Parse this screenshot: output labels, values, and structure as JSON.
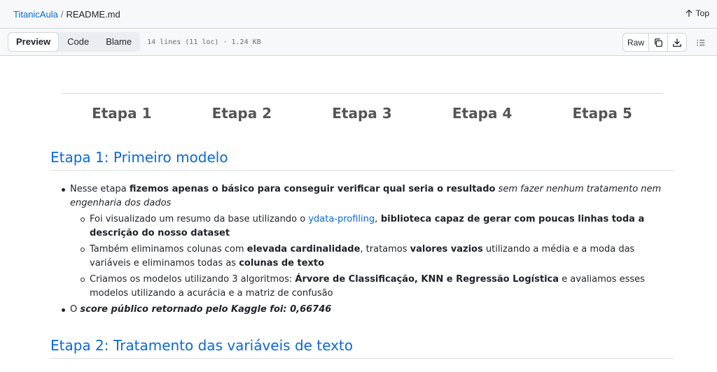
{
  "breadcrumb": {
    "repo": "TitanicAula",
    "separator": "/",
    "file": "README.md"
  },
  "top_link": {
    "label": "Top"
  },
  "toolbar": {
    "tabs": [
      {
        "label": "Preview"
      },
      {
        "label": "Code"
      },
      {
        "label": "Blame"
      }
    ],
    "meta": "14 lines (11 loc) · 1.24 KB",
    "raw_label": "Raw"
  },
  "steps": [
    "Etapa 1",
    "Etapa 2",
    "Etapa 3",
    "Etapa 4",
    "Etapa 5"
  ],
  "section1": {
    "title": "Etapa 1: Primeiro modelo",
    "bullet1": {
      "t1": "Nesse etapa ",
      "t2": "fizemos apenas o básico para conseguir verificar qual seria o resultado",
      "t3": " sem fazer nenhum tratamento nem engenharia dos dados"
    },
    "sub1": {
      "t1": "Foi visualizado um resumo da base utilizando o ",
      "link": "ydata-profiling",
      "t2": ",",
      "t3": " biblioteca capaz de gerar com poucas linhas toda a descrição do nosso dataset"
    },
    "sub2": {
      "t1": "Também eliminamos colunas com ",
      "t2": "elevada cardinalidade",
      "t3": ", tratamos ",
      "t4": "valores vazios",
      "t5": " utilizando a média e a moda das variáveis e eliminamos todas as ",
      "t6": "colunas de texto"
    },
    "sub3": {
      "t1": "Criamos os modelos utilizando 3 algoritmos: ",
      "t2": "Árvore de Classificação, KNN e Regressão Logística",
      "t3": " e avaliamos esses modelos utilizando a acurácia e a matriz de confusão"
    },
    "bullet2": {
      "t1": "O ",
      "t2": "score público retornado pelo Kaggle foi: 0,66746"
    }
  },
  "section2": {
    "title": "Etapa 2: Tratamento das variáveis de texto"
  },
  "icons": {
    "top": "arrow-up-icon",
    "copy": "copy-icon",
    "download": "download-icon",
    "outline": "list-unordered-icon"
  }
}
